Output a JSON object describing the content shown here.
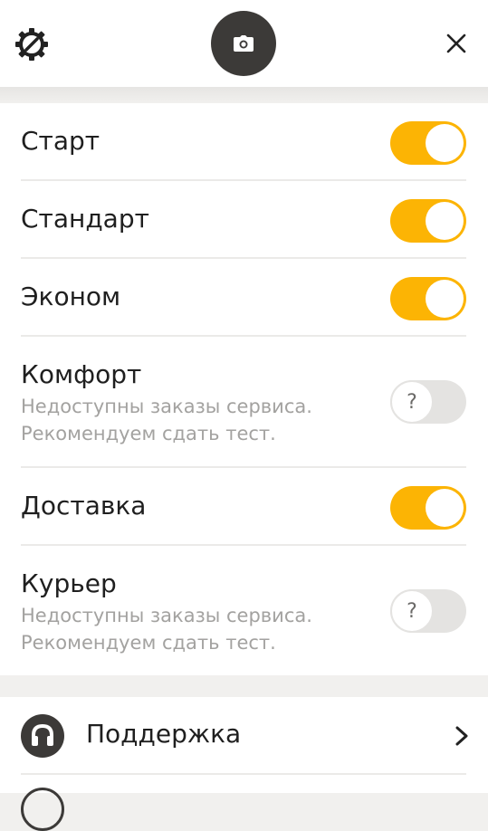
{
  "header": {
    "settings_icon": "gear-icon",
    "camera_icon": "camera-icon",
    "close_icon": "close-icon"
  },
  "tariffs": [
    {
      "name": "Старт",
      "enabled": true
    },
    {
      "name": "Стандарт",
      "enabled": true
    },
    {
      "name": "Эконом",
      "enabled": true
    },
    {
      "name": "Комфорт",
      "enabled": false,
      "note_line1": "Недоступны заказы сервиса.",
      "note_line2": "Рекомендуем сдать тест.",
      "toggle_mark": "?"
    },
    {
      "name": "Доставка",
      "enabled": true
    },
    {
      "name": "Курьер",
      "enabled": false,
      "note_line1": "Недоступны заказы сервиса.",
      "note_line2": "Рекомендуем сдать тест.",
      "toggle_mark": "?"
    }
  ],
  "menu": {
    "support_label": "Поддержка",
    "support_icon": "headset-icon",
    "chevron_icon": "chevron-right-icon"
  },
  "colors": {
    "accent": "#fcb404",
    "dark": "#3c3a38",
    "muted_text": "#a3a2a0",
    "toggle_off": "#e4e3e1"
  }
}
